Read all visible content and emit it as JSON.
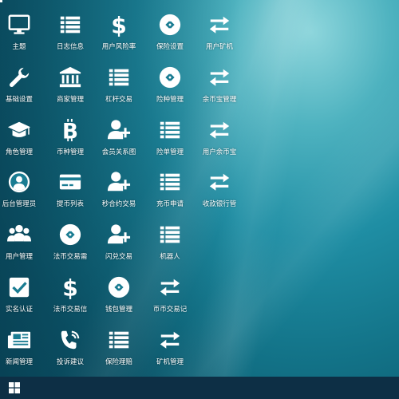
{
  "desktop": {
    "icons": [
      {
        "label": "主题",
        "icon": "monitor-icon"
      },
      {
        "label": "日志信息",
        "icon": "list-icon"
      },
      {
        "label": "用户风险率",
        "icon": "dollar-icon"
      },
      {
        "label": "保险设置",
        "icon": "shield-icon"
      },
      {
        "label": "用户矿机",
        "icon": "exchange-icon"
      },
      {
        "label": "基础设置",
        "icon": "wrench-icon"
      },
      {
        "label": "商家管理",
        "icon": "bank-icon"
      },
      {
        "label": "杠杆交易",
        "icon": "list-icon"
      },
      {
        "label": "险种管理",
        "icon": "shield-icon"
      },
      {
        "label": "余币宝管理",
        "icon": "exchange-icon"
      },
      {
        "label": "角色管理",
        "icon": "graduation-cap-icon"
      },
      {
        "label": "币种管理",
        "icon": "bitcoin-icon"
      },
      {
        "label": "会员关系图",
        "icon": "user-plus-icon"
      },
      {
        "label": "险单管理",
        "icon": "list-icon"
      },
      {
        "label": "用户余币宝",
        "icon": "exchange-icon"
      },
      {
        "label": "后台管理员",
        "icon": "user-circle-icon"
      },
      {
        "label": "提币列表",
        "icon": "credit-card-icon"
      },
      {
        "label": "秒合约交易",
        "icon": "user-plus-icon"
      },
      {
        "label": "充币申请",
        "icon": "list-icon"
      },
      {
        "label": "收款银行管",
        "icon": "exchange-icon"
      },
      {
        "label": "用户管理",
        "icon": "users-icon"
      },
      {
        "label": "法币交易需",
        "icon": "shield-icon"
      },
      {
        "label": "闪兑交易",
        "icon": "user-plus-icon"
      },
      {
        "label": "机器人",
        "icon": "list-icon"
      },
      {
        "label": "实名认证",
        "icon": "check-square-icon"
      },
      {
        "label": "法币交易信",
        "icon": "dollar-icon"
      },
      {
        "label": "钱包管理",
        "icon": "shield-icon"
      },
      {
        "label": "币币交易记",
        "icon": "exchange-icon"
      },
      {
        "label": "新闻管理",
        "icon": "newspaper-icon"
      },
      {
        "label": "投诉建议",
        "icon": "phone-icon"
      },
      {
        "label": "保险理赔",
        "icon": "list-icon"
      },
      {
        "label": "矿机管理",
        "icon": "exchange-icon"
      }
    ]
  },
  "taskbar": {
    "start_icon": "windows-start-icon",
    "color": "#0d2f45"
  }
}
